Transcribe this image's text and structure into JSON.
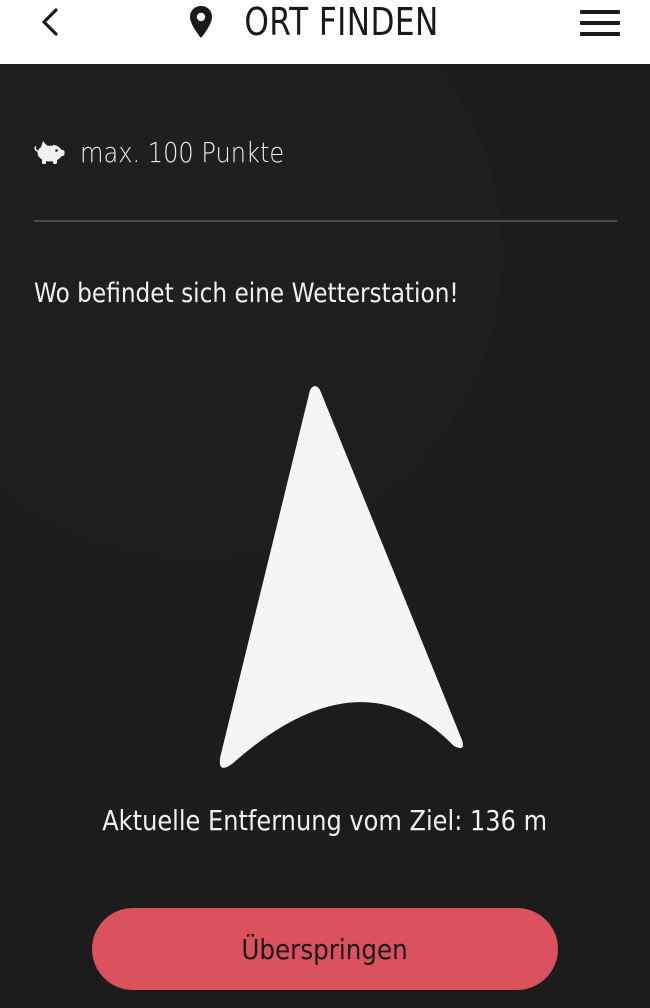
{
  "header": {
    "title": "ORT FINDEN",
    "back_icon": "chevron-left-icon",
    "pin_icon": "map-pin-icon",
    "menu_icon": "hamburger-menu-icon"
  },
  "main": {
    "points": {
      "icon": "piggy-bank-icon",
      "label": "max. 100 Punkte"
    },
    "question": "Wo befindet sich eine Wetterstation!",
    "compass_arrow_icon": "direction-arrow-icon",
    "distance": "Aktuelle Entfernung vom Ziel: 136 m",
    "skip_button_label": "Überspringen"
  },
  "colors": {
    "header_bg": "#ffffff",
    "main_bg": "#1c1c1c",
    "accent": "#d9525e",
    "text_light": "#f0f0f0",
    "text_dark": "#1a1a1a"
  }
}
